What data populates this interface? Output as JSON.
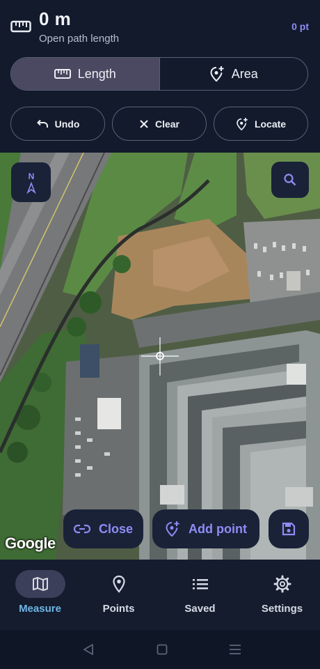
{
  "header": {
    "distance": "0 m",
    "subtitle": "Open path length",
    "point_count": "0 pt"
  },
  "mode_toggle": {
    "length_label": "Length",
    "area_label": "Area",
    "selected": "Length"
  },
  "actions": {
    "undo": "Undo",
    "clear": "Clear",
    "locate": "Locate"
  },
  "map": {
    "compass_label": "N",
    "attribution": "Google",
    "close_label": "Close",
    "add_point_label": "Add point"
  },
  "bottom_nav": {
    "items": [
      {
        "label": "Measure",
        "icon": "map-icon",
        "active": true
      },
      {
        "label": "Points",
        "icon": "location-pin-icon",
        "active": false
      },
      {
        "label": "Saved",
        "icon": "list-icon",
        "active": false
      },
      {
        "label": "Settings",
        "icon": "gear-icon",
        "active": false
      }
    ]
  },
  "colors": {
    "accent": "#8e8df5",
    "background": "#121a2c",
    "active_segment": "#4b4861",
    "active_nav": "#6fb6e6"
  }
}
